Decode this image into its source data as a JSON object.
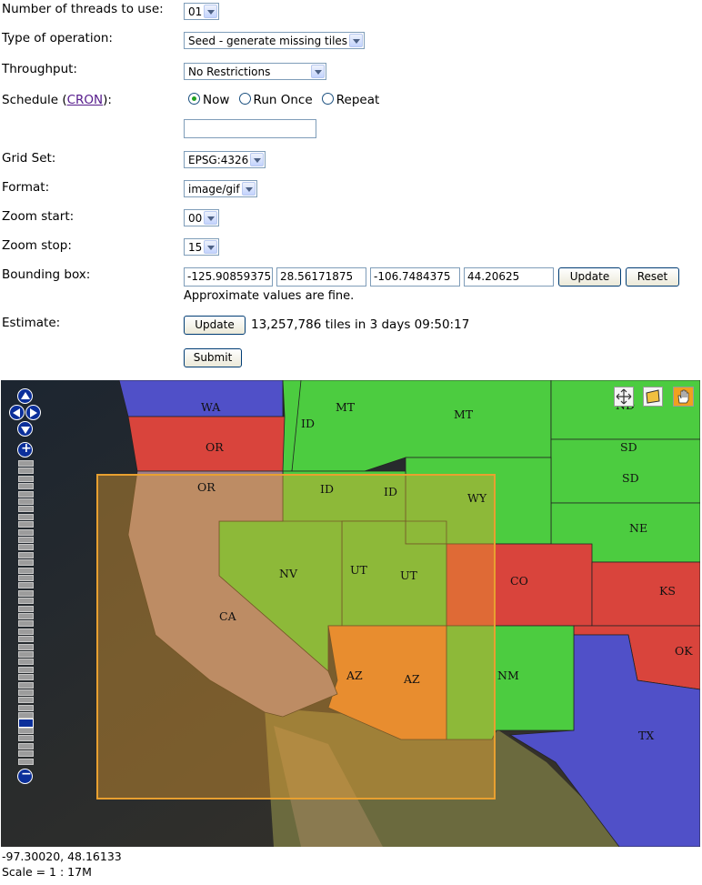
{
  "form": {
    "threads": {
      "label": "Number of threads to use:",
      "value": "01"
    },
    "operation": {
      "label": "Type of operation:",
      "value": "Seed - generate missing tiles"
    },
    "throughput": {
      "label": "Throughput:",
      "value": "No Restrictions"
    },
    "schedule": {
      "label_prefix": "Schedule (",
      "link": "CRON",
      "label_suffix": "):",
      "options": [
        "Now",
        "Run Once",
        "Repeat"
      ],
      "selected": "Now",
      "cron_value": ""
    },
    "gridset": {
      "label": "Grid Set:",
      "value": "EPSG:4326"
    },
    "format": {
      "label": "Format:",
      "value": "image/gif"
    },
    "zoom_start": {
      "label": "Zoom start:",
      "value": "00"
    },
    "zoom_stop": {
      "label": "Zoom stop:",
      "value": "15"
    },
    "bbox": {
      "label": "Bounding box:",
      "minx": "-125.90859375",
      "miny": "28.56171875",
      "maxx": "-106.7484375",
      "maxy": "44.20625",
      "update": "Update",
      "reset": "Reset",
      "hint": "Approximate values are fine."
    },
    "estimate": {
      "label": "Estimate:",
      "button": "Update",
      "result": "13,257,786 tiles in 3 days 09:50:17"
    },
    "submit": "Submit"
  },
  "map": {
    "state_labels": [
      "WA",
      "MT",
      "ID",
      "MT",
      "OR",
      "ND",
      "SD",
      "SD",
      "OR",
      "ID",
      "ID",
      "WY",
      "NE",
      "NV",
      "UT",
      "UT",
      "CO",
      "KS",
      "CA",
      "AZ",
      "AZ",
      "NM",
      "OK",
      "TX"
    ],
    "colors": {
      "green": "#4ccc40",
      "red": "#d9443c",
      "blue": "#5050c8",
      "orange": "#e98030",
      "lime": "#9acd40",
      "mauve": "#9f7f8a",
      "selection": "#e8a030"
    },
    "tools": [
      "pan-arrows-icon",
      "zoom-box-icon",
      "hand-icon"
    ]
  },
  "footer": {
    "coords": "-97.30020, 48.16133",
    "scale": "Scale = 1 : 17M"
  }
}
